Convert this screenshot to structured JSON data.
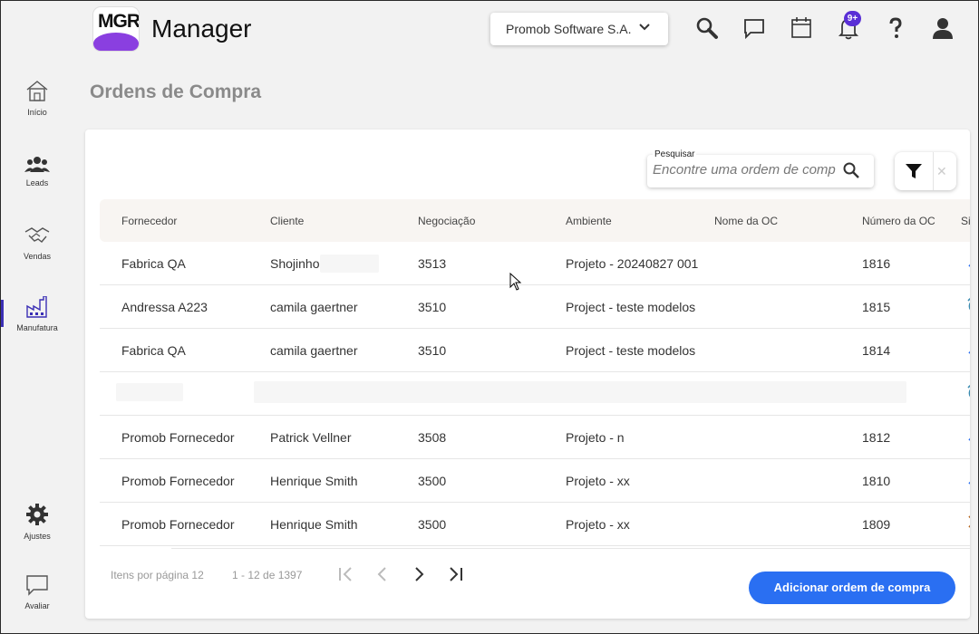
{
  "brand": {
    "logo_text": "MGR",
    "app_title": "Manager",
    "accent": "#2a6ff2",
    "logo_purple": "#8a3fe0"
  },
  "sidebar": {
    "items": [
      {
        "label": "Início",
        "icon": "home-icon"
      },
      {
        "label": "Leads",
        "icon": "users-icon"
      },
      {
        "label": "Vendas",
        "icon": "handshake-icon"
      },
      {
        "label": "Manufatura",
        "icon": "factory-icon",
        "active": true
      },
      {
        "label": "Ajustes",
        "icon": "gear-icon"
      },
      {
        "label": "Avaliar",
        "icon": "chat-bubble-icon"
      }
    ]
  },
  "header": {
    "company": "Promob Software S.A.",
    "notification_badge": "9+",
    "icons": [
      "search-icon",
      "chat-icon",
      "calendar-icon",
      "bell-icon",
      "help-icon",
      "user-icon"
    ]
  },
  "page": {
    "title": "Ordens de Compra"
  },
  "search": {
    "label": "Pesquisar",
    "placeholder": "Encontre uma ordem de compra"
  },
  "table": {
    "columns": [
      "Fornecedor",
      "Cliente",
      "Negociação",
      "Ambiente",
      "Nome da OC",
      "Número da OC",
      "Situ"
    ],
    "rows": [
      {
        "fornecedor": "Fabrica QA",
        "cliente": "Shojinho",
        "negociacao": "3513",
        "ambiente": "Projeto - 20240827 001",
        "nome_oc": "",
        "numero_oc": "1816",
        "status_icon": "arrow-up-right-icon"
      },
      {
        "fornecedor": "Andressa A223",
        "cliente": "camila gaertner",
        "negociacao": "3510",
        "ambiente": "Project - teste modelos",
        "nome_oc": "",
        "numero_oc": "1815",
        "status_icon": "alarm-icon"
      },
      {
        "fornecedor": "Fabrica QA",
        "cliente": "camila gaertner",
        "negociacao": "3510",
        "ambiente": "Project - teste modelos",
        "nome_oc": "",
        "numero_oc": "1814",
        "status_icon": "arrow-up-right-icon"
      },
      {
        "fornecedor": "",
        "cliente": "",
        "negociacao": "",
        "ambiente": "",
        "nome_oc": "",
        "numero_oc": "",
        "status_icon": "alarm-icon"
      },
      {
        "fornecedor": "Promob Fornecedor",
        "cliente": "Patrick Vellner",
        "negociacao": "3508",
        "ambiente": "Projeto - n",
        "nome_oc": "",
        "numero_oc": "1812",
        "status_icon": "arrow-up-right-icon"
      },
      {
        "fornecedor": "Promob Fornecedor",
        "cliente": "Henrique Smith",
        "negociacao": "3500",
        "ambiente": "Projeto - xx",
        "nome_oc": "",
        "numero_oc": "1810",
        "status_icon": "arrow-up-right-icon"
      },
      {
        "fornecedor": "Promob Fornecedor",
        "cliente": "Henrique Smith",
        "negociacao": "3500",
        "ambiente": "Projeto - xx",
        "nome_oc": "",
        "numero_oc": "1809",
        "status_icon": "close-icon"
      }
    ]
  },
  "pagination": {
    "items_per_page": "Itens por página 12",
    "range": "1 - 12 de 1397"
  },
  "actions": {
    "add_label": "Adicionar ordem de compra"
  }
}
